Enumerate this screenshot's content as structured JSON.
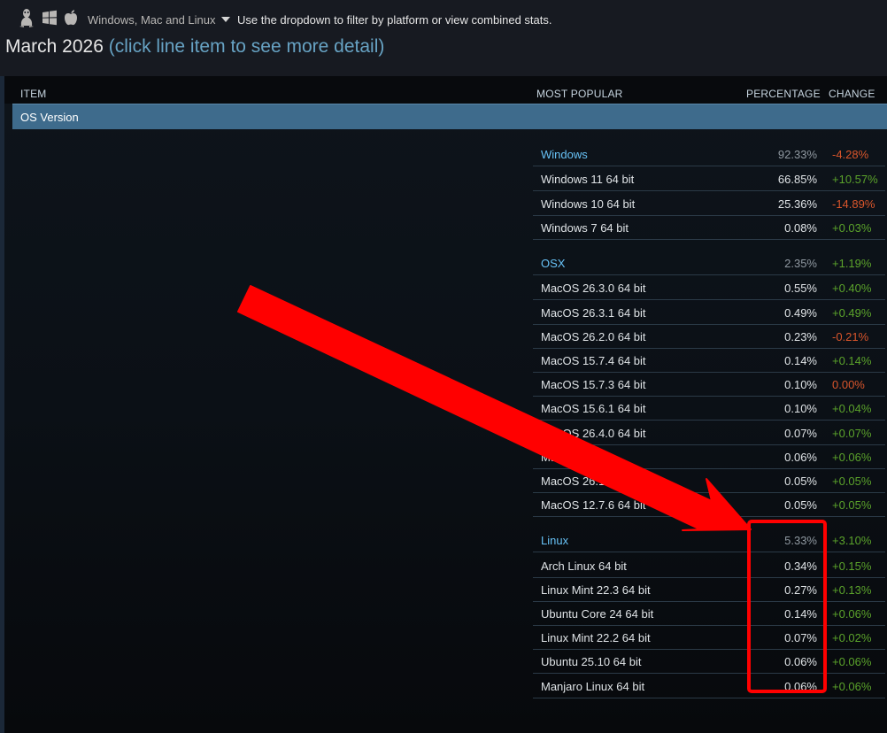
{
  "filter": {
    "selected": "Windows, Mac and Linux",
    "hint": "Use the dropdown to filter by platform or view combined stats.",
    "icons": [
      "linux-icon",
      "windows-icon",
      "apple-icon"
    ]
  },
  "title": {
    "main": "March 2026",
    "hint": "(click line item to see more detail)"
  },
  "columns": {
    "item": "ITEM",
    "most_popular": "MOST POPULAR",
    "percentage": "PERCENTAGE",
    "change": "CHANGE"
  },
  "section": {
    "label": "OS Version"
  },
  "groups": [
    {
      "name": "Windows",
      "pct": "92.33%",
      "chg": "-4.28%",
      "chg_sign": "neg",
      "rows": [
        {
          "name": "Windows 11 64 bit",
          "pct": "66.85%",
          "chg": "+10.57%",
          "chg_sign": "pos"
        },
        {
          "name": "Windows 10 64 bit",
          "pct": "25.36%",
          "chg": "-14.89%",
          "chg_sign": "neg"
        },
        {
          "name": "Windows 7 64 bit",
          "pct": "0.08%",
          "chg": "+0.03%",
          "chg_sign": "pos"
        }
      ]
    },
    {
      "name": "OSX",
      "pct": "2.35%",
      "chg": "+1.19%",
      "chg_sign": "pos",
      "rows": [
        {
          "name": "MacOS 26.3.0 64 bit",
          "pct": "0.55%",
          "chg": "+0.40%",
          "chg_sign": "pos"
        },
        {
          "name": "MacOS 26.3.1 64 bit",
          "pct": "0.49%",
          "chg": "+0.49%",
          "chg_sign": "pos"
        },
        {
          "name": "MacOS 26.2.0 64 bit",
          "pct": "0.23%",
          "chg": "-0.21%",
          "chg_sign": "neg"
        },
        {
          "name": "MacOS 15.7.4 64 bit",
          "pct": "0.14%",
          "chg": "+0.14%",
          "chg_sign": "pos"
        },
        {
          "name": "MacOS 15.7.3 64 bit",
          "pct": "0.10%",
          "chg": "0.00%",
          "chg_sign": "zero"
        },
        {
          "name": "MacOS 15.6.1 64 bit",
          "pct": "0.10%",
          "chg": "+0.04%",
          "chg_sign": "pos"
        },
        {
          "name": "MacOS 26.4.0 64 bit",
          "pct": "0.07%",
          "chg": "+0.07%",
          "chg_sign": "pos"
        },
        {
          "name": "MacOS",
          "pct": "0.06%",
          "chg": "+0.06%",
          "chg_sign": "pos"
        },
        {
          "name": "MacOS 26.1.0",
          "pct": "0.05%",
          "chg": "+0.05%",
          "chg_sign": "pos"
        },
        {
          "name": "MacOS 12.7.6 64 bit",
          "pct": "0.05%",
          "chg": "+0.05%",
          "chg_sign": "pos"
        }
      ]
    },
    {
      "name": "Linux",
      "pct": "5.33%",
      "chg": "+3.10%",
      "chg_sign": "pos",
      "rows": [
        {
          "name": "Arch Linux 64 bit",
          "pct": "0.34%",
          "chg": "+0.15%",
          "chg_sign": "pos"
        },
        {
          "name": "Linux Mint 22.3 64 bit",
          "pct": "0.27%",
          "chg": "+0.13%",
          "chg_sign": "pos"
        },
        {
          "name": "Ubuntu Core 24 64 bit",
          "pct": "0.14%",
          "chg": "+0.06%",
          "chg_sign": "pos"
        },
        {
          "name": "Linux Mint 22.2 64 bit",
          "pct": "0.07%",
          "chg": "+0.02%",
          "chg_sign": "pos"
        },
        {
          "name": "Ubuntu 25.10 64 bit",
          "pct": "0.06%",
          "chg": "+0.06%",
          "chg_sign": "pos"
        },
        {
          "name": "Manjaro Linux 64 bit",
          "pct": "0.06%",
          "chg": "+0.06%",
          "chg_sign": "pos"
        }
      ]
    }
  ],
  "colors": {
    "header_bg": "#171a21",
    "section_bar": "#3e6b8c",
    "group_name": "#67c1f5",
    "positive": "#5ba32b",
    "negative": "#d9552b",
    "annotation": "#ff0000"
  }
}
